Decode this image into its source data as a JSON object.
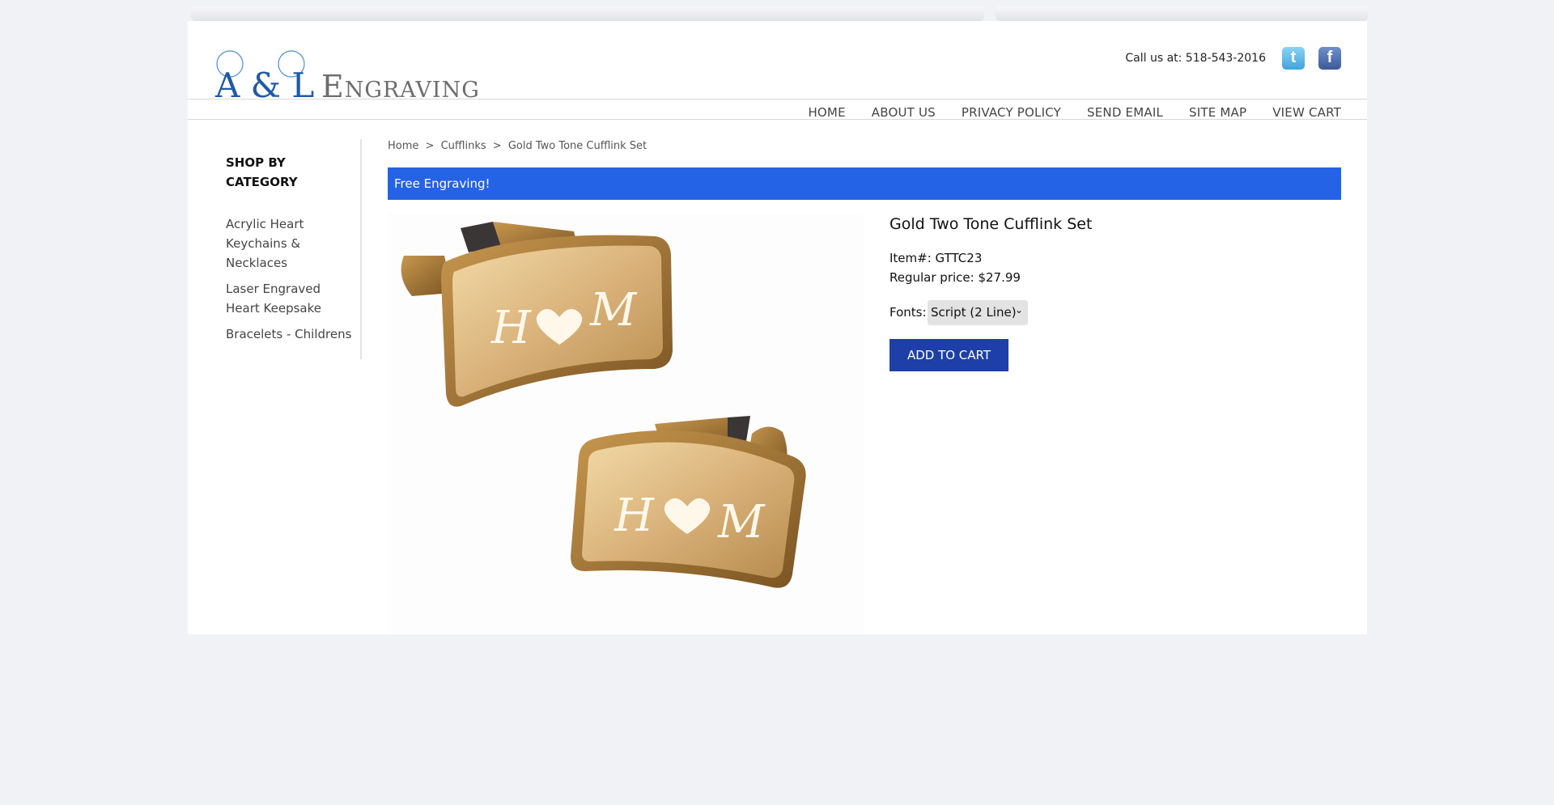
{
  "header": {
    "logo_text_primary": "A & L",
    "logo_text_secondary": "Engraving",
    "phone_label": "Call us at: 518-543-2016",
    "social": [
      {
        "name": "twitter",
        "icon": "twitter-icon",
        "color": "#3fa4dc"
      },
      {
        "name": "facebook",
        "icon": "facebook-icon",
        "color": "#3b5998"
      }
    ]
  },
  "nav": {
    "items": [
      "HOME",
      "ABOUT US",
      "PRIVACY POLICY",
      "SEND EMAIL",
      "SITE MAP",
      "VIEW CART"
    ]
  },
  "sidebar": {
    "heading_line1": "SHOP BY",
    "heading_line2": "CATEGORY",
    "items": [
      {
        "label": "Acrylic Heart Keychains & Necklaces"
      },
      {
        "label": "Laser Engraved Heart Keepsake"
      },
      {
        "label": "Bracelets - Childrens"
      }
    ]
  },
  "breadcrumb": {
    "items": [
      "Home",
      "Cufflinks",
      "Gold Two Tone Cufflink Set"
    ],
    "separator": ">"
  },
  "promo": {
    "text": "Free Engraving!",
    "color": "#2563e6"
  },
  "product": {
    "title": "Gold Two Tone Cufflink Set",
    "item_number": "Item#: GTTC23",
    "price": "Regular price: $27.99",
    "fonts_label": "Fonts:",
    "fonts_selected": "Script (2 Line)",
    "add_to_cart_label": "ADD TO CART",
    "button_color": "#1f3fa8",
    "engraving_left": "H",
    "engraving_right": "M"
  }
}
